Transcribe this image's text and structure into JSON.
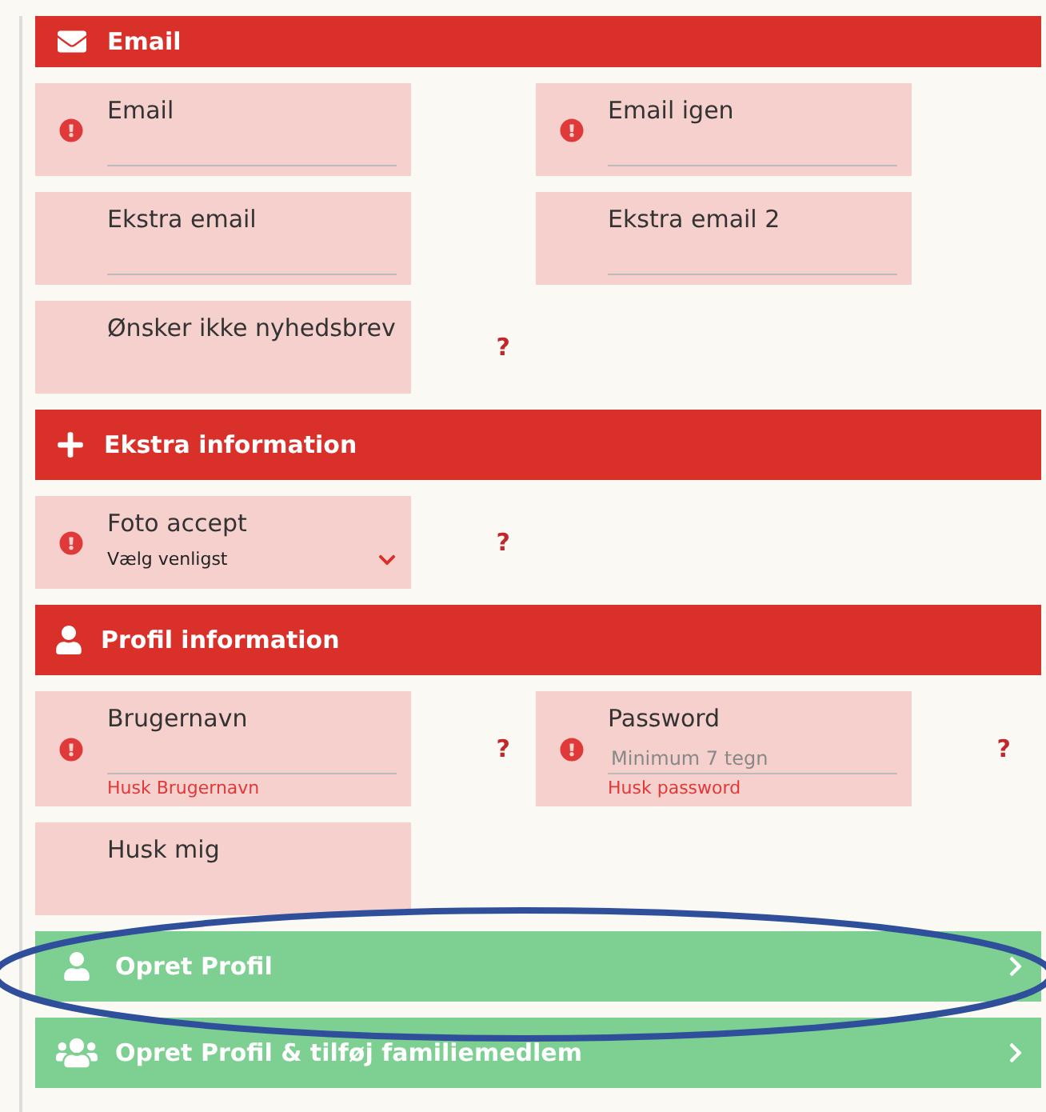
{
  "sections": [
    {
      "title": "Email",
      "kind": "envelope",
      "rows": [
        {
          "fields": [
            {
              "label": "Email",
              "kind": "text",
              "required": true
            },
            {
              "label": "Email igen",
              "kind": "text",
              "required": true
            }
          ]
        },
        {
          "fields": [
            {
              "label": "Ekstra email",
              "kind": "text",
              "required": false
            },
            {
              "label": "Ekstra email 2",
              "kind": "text",
              "required": false
            }
          ]
        },
        {
          "fields": [
            {
              "label": "Ønsker ikke nyhedsbrev",
              "kind": "plain",
              "required": false,
              "help_text": "?"
            }
          ]
        }
      ]
    },
    {
      "title": "Ekstra information",
      "kind": "plus",
      "rows": [
        {
          "fields": [
            {
              "label": "Foto accept",
              "kind": "select",
              "value": "Vælg venligst",
              "required": true,
              "help_text": "?"
            }
          ]
        }
      ]
    },
    {
      "title": "Profil information",
      "kind": "user",
      "rows": [
        {
          "fields": [
            {
              "label": "Brugernavn",
              "kind": "text",
              "required": true,
              "help_text": "?",
              "hint": "Husk Brugernavn"
            },
            {
              "label": "Password",
              "kind": "text",
              "placeholder": "Minimum 7 tegn",
              "required": true,
              "help_text": "?",
              "hint": "Husk password"
            }
          ]
        },
        {
          "fields": [
            {
              "label": "Husk mig",
              "kind": "plain",
              "required": false
            }
          ]
        }
      ]
    }
  ],
  "actions": [
    {
      "label": "Opret Profil",
      "kind": "user",
      "highlighted": true
    },
    {
      "label": "Opret Profil & tilføj familiemedlem",
      "kind": "users",
      "highlighted": false
    }
  ]
}
